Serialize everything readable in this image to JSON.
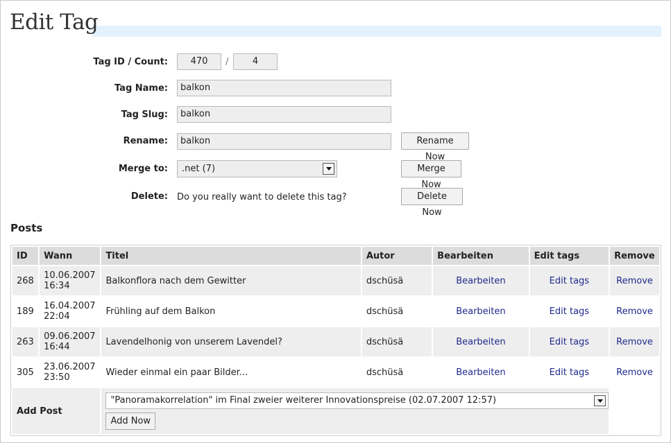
{
  "page": {
    "title": "Edit Tag"
  },
  "form": {
    "id_count_label": "Tag ID / Count:",
    "tag_id": "470",
    "separator": "/",
    "count": "4",
    "name_label": "Tag Name:",
    "name_value": "balkon",
    "slug_label": "Tag Slug:",
    "slug_value": "balkon",
    "rename_label": "Rename:",
    "rename_value": "balkon",
    "rename_button": "Rename Now",
    "merge_label": "Merge to:",
    "merge_selected": ".net (7)",
    "merge_button": "Merge Now",
    "delete_label": "Delete:",
    "delete_question": "Do you really want to delete this tag?",
    "delete_button": "Delete Now"
  },
  "posts": {
    "title": "Posts",
    "columns": [
      "ID",
      "Wann",
      "Titel",
      "Autor",
      "Bearbeiten",
      "Edit tags",
      "Remove"
    ],
    "rows": [
      {
        "id": "268",
        "date": "10.06.2007",
        "time": "16:34",
        "title": "Balkonflora nach dem Gewitter",
        "author": "dschüsä",
        "edit": "Bearbeiten",
        "edit_tags": "Edit tags",
        "remove": "Remove"
      },
      {
        "id": "189",
        "date": "16.04.2007",
        "time": "22:04",
        "title": "Frühling auf dem Balkon",
        "author": "dschüsä",
        "edit": "Bearbeiten",
        "edit_tags": "Edit tags",
        "remove": "Remove"
      },
      {
        "id": "263",
        "date": "09.06.2007",
        "time": "16:44",
        "title": "Lavendelhonig von unserem Lavendel?",
        "author": "dschüsä",
        "edit": "Bearbeiten",
        "edit_tags": "Edit tags",
        "remove": "Remove"
      },
      {
        "id": "305",
        "date": "23.06.2007",
        "time": "23:50",
        "title": "Wieder einmal ein paar Bilder...",
        "author": "dschüsä",
        "edit": "Bearbeiten",
        "edit_tags": "Edit tags",
        "remove": "Remove"
      }
    ],
    "add_label": "Add Post",
    "add_selected": "\"Panoramakorrelation\" im Final zweier weiterer Innovationspreise (02.07.2007 12:57)",
    "add_button": "Add Now"
  },
  "colors": {
    "title_bar": "#e4f2fd",
    "link": "#1f2a8c",
    "header_bg": "#dcdcdc",
    "row_odd": "#eeeeee"
  }
}
